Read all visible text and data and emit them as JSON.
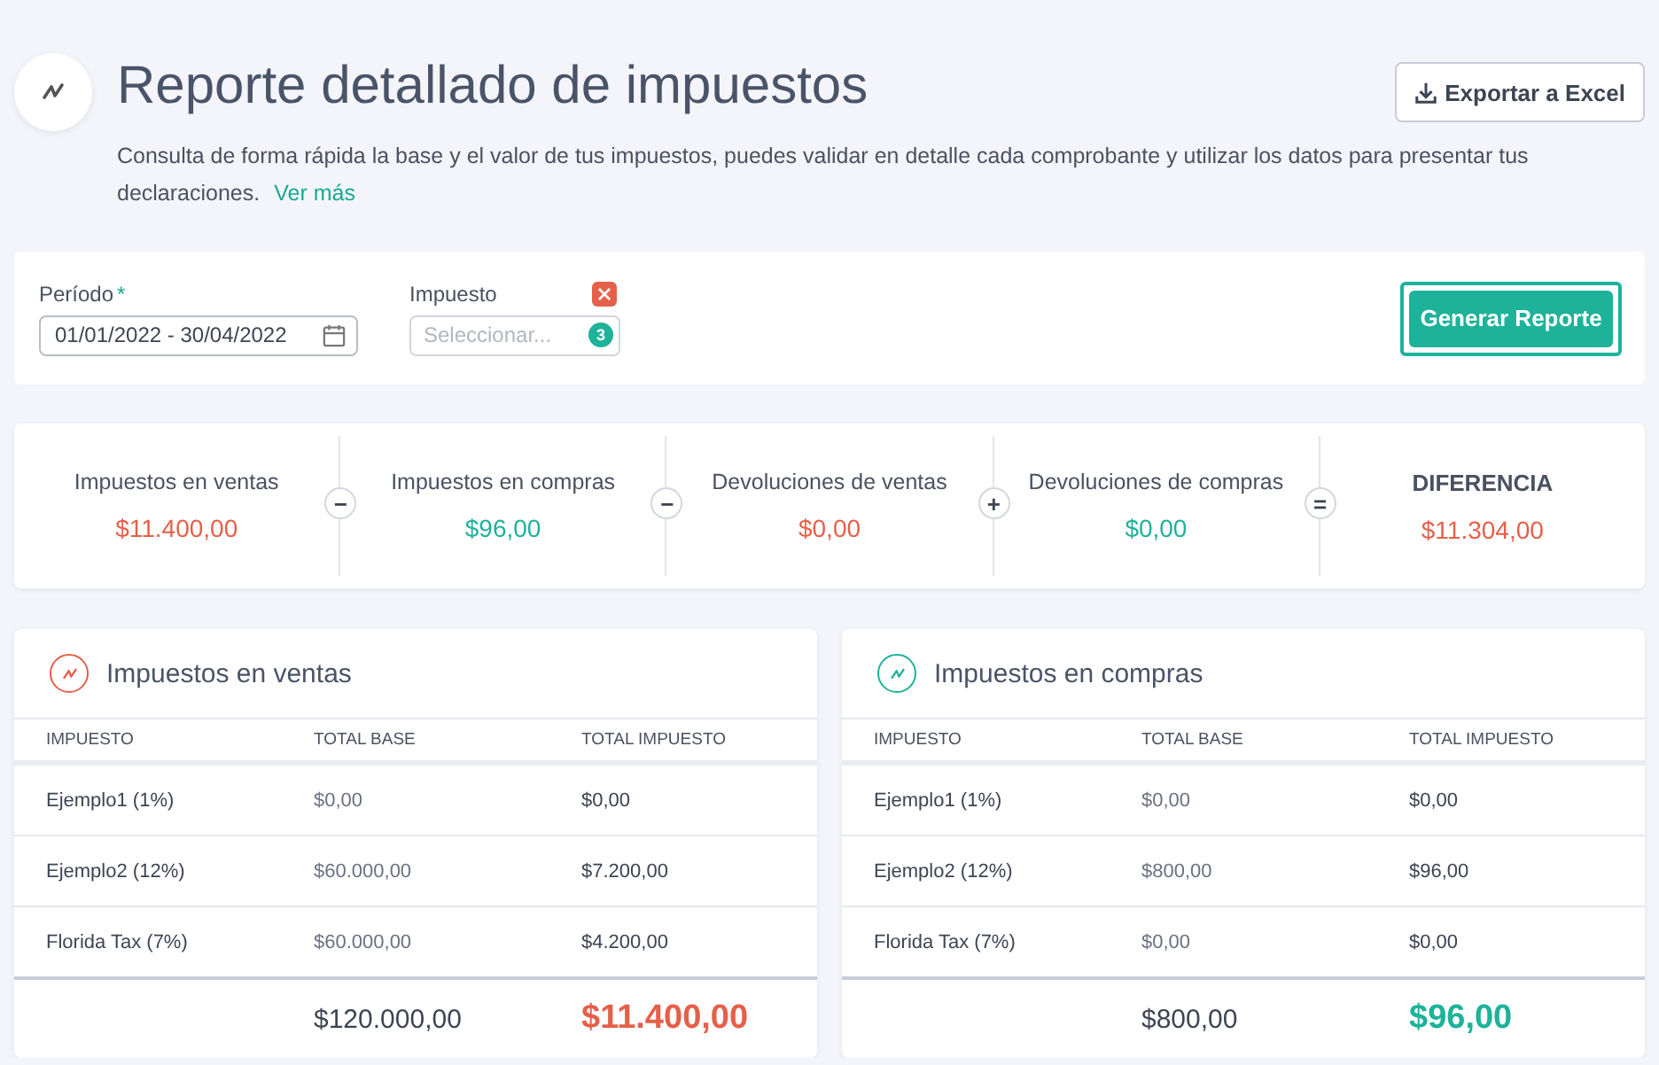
{
  "header": {
    "title": "Reporte detallado de impuestos",
    "description": "Consulta de forma rápida la base y el valor de tus impuestos, puedes validar en detalle cada comprobante y utilizar los datos para presentar tus declaraciones.",
    "link": "Ver más",
    "export_button": "Exportar a Excel"
  },
  "filters": {
    "period": {
      "label": "Período",
      "required_mark": "*",
      "value": "01/01/2022 - 30/04/2022"
    },
    "tax": {
      "label": "Impuesto",
      "placeholder": "Seleccionar...",
      "count": "3"
    },
    "generate_button": {
      "label": "Generar Reporte",
      "focused": true
    }
  },
  "summary": [
    {
      "label": "Impuestos en ventas",
      "value": "$11.400,00",
      "color": "#e5604a",
      "kind": "term"
    },
    {
      "operator": "−",
      "label": "Impuestos en compras",
      "value": "$96,00",
      "color": "#1eb29a",
      "kind": "term"
    },
    {
      "operator": "−",
      "label": "Devoluciones de ventas",
      "value": "$0,00",
      "color": "#e5604a",
      "kind": "term"
    },
    {
      "operator": "+",
      "label": "Devoluciones de compras",
      "value": "$0,00",
      "color": "#1eb29a",
      "kind": "term"
    },
    {
      "operator": "=",
      "label": "DIFERENCIA",
      "value": "$11.304,00",
      "color": "#e5604a",
      "kind": "total"
    }
  ],
  "panels": [
    {
      "title": "Impuestos en ventas",
      "color": "#e5604a",
      "columns": [
        "IMPUESTO",
        "TOTAL BASE",
        "TOTAL IMPUESTO"
      ],
      "rows": [
        [
          "Ejemplo1 (1%)",
          "$0,00",
          "$0,00"
        ],
        [
          "Ejemplo2 (12%)",
          "$60.000,00",
          "$7.200,00"
        ],
        [
          "Florida Tax (7%)",
          "$60.000,00",
          "$4.200,00"
        ]
      ],
      "total_base": "$120.000,00",
      "total_tax": "$11.400,00"
    },
    {
      "title": "Impuestos en compras",
      "color": "#1eb29a",
      "columns": [
        "IMPUESTO",
        "TOTAL BASE",
        "TOTAL IMPUESTO"
      ],
      "rows": [
        [
          "Ejemplo1 (1%)",
          "$0,00",
          "$0,00"
        ],
        [
          "Ejemplo2 (12%)",
          "$800,00",
          "$96,00"
        ],
        [
          "Florida Tax (7%)",
          "$0,00",
          "$0,00"
        ]
      ],
      "total_base": "$800,00",
      "total_tax": "$96,00"
    }
  ]
}
